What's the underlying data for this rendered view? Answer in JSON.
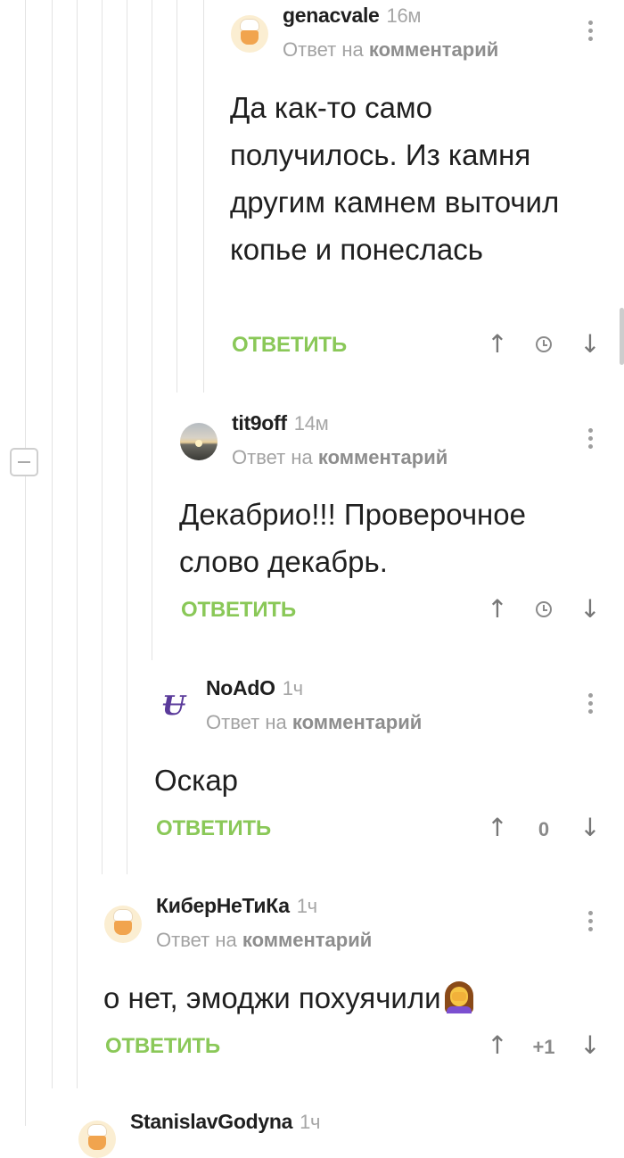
{
  "ui": {
    "reply_button": "ОТВЕТИТЬ",
    "reply_to_prefix": "Ответ на",
    "reply_to_target": "комментарий",
    "accent_color": "#8ac858"
  },
  "comments": [
    {
      "user": "genacvale",
      "time": "16м",
      "avatar": "chef-avatar",
      "text": "Да как-то само получилось. Из камня другим камнем выточил копье и понеслась",
      "score": ""
    },
    {
      "user": "tit9off",
      "time": "14м",
      "avatar": "sunset-avatar",
      "text": "Декабрио!!! Проверочное слово декабрь.",
      "score": ""
    },
    {
      "user": "NoAdO",
      "time": "1ч",
      "avatar": "logo-avatar",
      "text": "Оскар",
      "score": "0"
    },
    {
      "user": "КиберНеТиКа",
      "time": "1ч",
      "avatar": "chef-avatar",
      "text": "о нет, эмоджи похуячили",
      "score": "+1"
    },
    {
      "user": "StanislavGodyna",
      "time": "1ч",
      "avatar": "chef-avatar",
      "text": "",
      "score": ""
    }
  ]
}
